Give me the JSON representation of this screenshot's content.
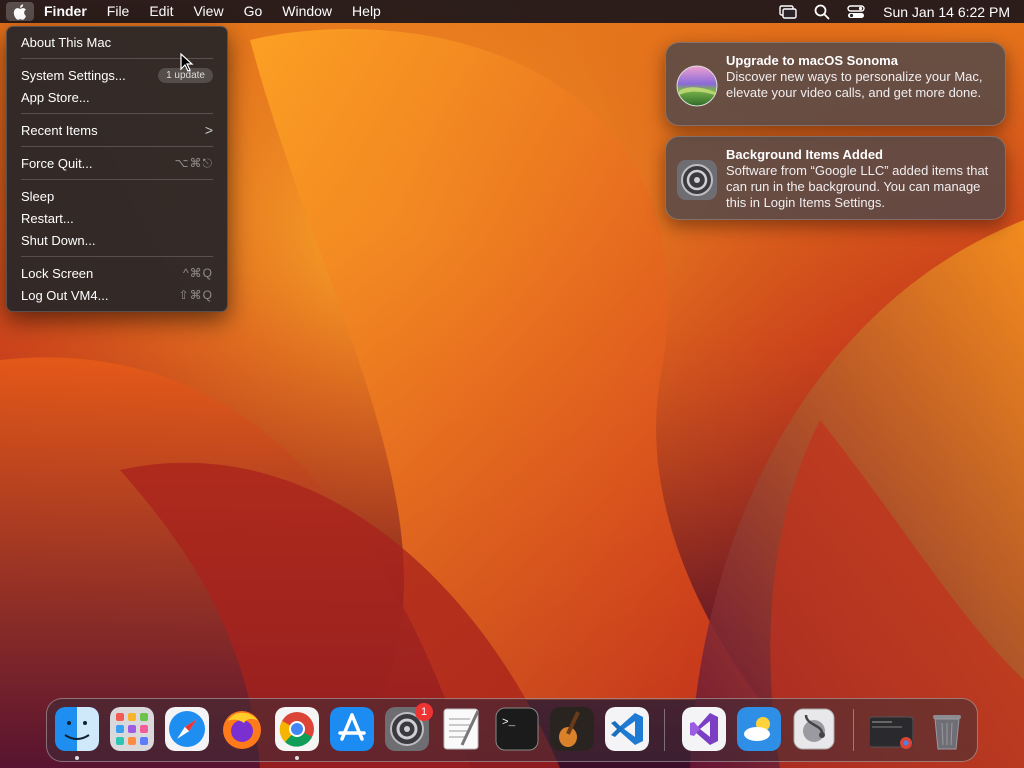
{
  "menubar": {
    "app_name": "Finder",
    "menus": [
      "File",
      "Edit",
      "View",
      "Go",
      "Window",
      "Help"
    ],
    "clock": "Sun Jan 14  6:22 PM",
    "status_icons": [
      "screen-mirroring-icon",
      "search-icon",
      "control-center-icon"
    ]
  },
  "apple_menu": {
    "items": [
      {
        "label": "About This Mac"
      },
      {
        "label": "System Settings...",
        "badge": "1 update"
      },
      {
        "label": "App Store..."
      },
      {
        "label": "Recent Items",
        "submenu": ">"
      },
      {
        "label": "Force Quit...",
        "shortcut": "⌥⌘⎋"
      },
      {
        "label": "Sleep"
      },
      {
        "label": "Restart..."
      },
      {
        "label": "Shut Down..."
      },
      {
        "label": "Lock Screen",
        "shortcut": "^⌘Q"
      },
      {
        "label": "Log Out VM4...",
        "shortcut": "⇧⌘Q"
      }
    ]
  },
  "notifications": [
    {
      "title": "Upgrade to macOS Sonoma",
      "body": "Discover new ways to personalize your Mac, elevate your video calls, and get more done.",
      "icon": "macos-sonoma-icon"
    },
    {
      "title": "Background Items Added",
      "body": "Software from “Google LLC” added items that can run in the background. You can manage this in Login Items Settings.",
      "icon": "system-settings-icon"
    }
  ],
  "dock": {
    "apps": [
      {
        "name": "finder",
        "running": true
      },
      {
        "name": "launchpad",
        "running": false
      },
      {
        "name": "safari",
        "running": false
      },
      {
        "name": "firefox",
        "running": false
      },
      {
        "name": "chrome",
        "running": true
      },
      {
        "name": "app-store",
        "running": false
      },
      {
        "name": "system-settings",
        "running": false,
        "badge": "1"
      },
      {
        "name": "textedit",
        "running": false
      },
      {
        "name": "terminal",
        "running": false
      },
      {
        "name": "garageband",
        "running": false
      },
      {
        "name": "vscode",
        "running": false
      },
      {
        "name": "visual-studio",
        "running": false
      },
      {
        "name": "weather",
        "running": false
      },
      {
        "name": "disk-utility",
        "running": false
      },
      {
        "name": "chrome-window",
        "running": false
      },
      {
        "name": "trash",
        "running": false
      }
    ]
  },
  "colors": {
    "wallpaper_orange": "#f08a1a",
    "wallpaper_red": "#c8321a",
    "wallpaper_dark": "#2a0c24",
    "badge_red": "#e33333"
  }
}
